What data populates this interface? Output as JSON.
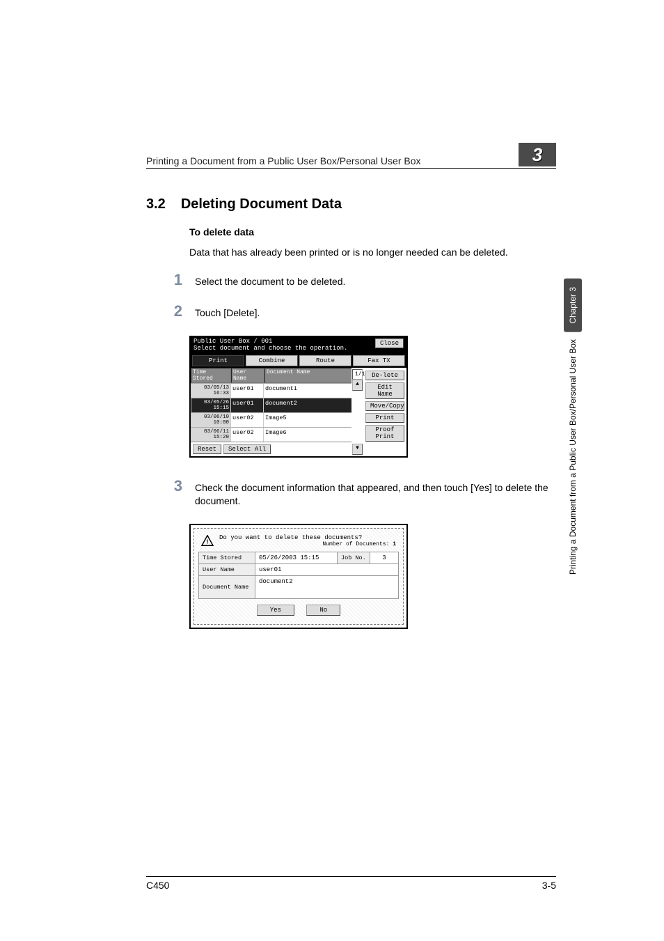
{
  "header": {
    "running_title": "Printing a Document from a Public User Box/Personal User Box",
    "chapter_number": "3"
  },
  "section": {
    "number": "3.2",
    "title": "Deleting Document Data",
    "subheading": "To delete data",
    "intro": "Data that has already been printed or is no longer needed can be deleted."
  },
  "steps": [
    {
      "n": "1",
      "text": "Select the document to be deleted."
    },
    {
      "n": "2",
      "text": "Touch [Delete]."
    },
    {
      "n": "3",
      "text": "Check the document information that appeared, and then touch [Yes] to delete the document."
    }
  ],
  "panel1": {
    "box_label": "Public User Box",
    "box_no": "/ 001",
    "instruction": "Select document and choose the operation.",
    "close": "Close",
    "tabs": [
      "Print",
      "Combine",
      "Route",
      "Fax TX"
    ],
    "col_time": "Time Stored",
    "col_user": "User Name",
    "col_doc": "Document Name",
    "page_indicator": "1/1",
    "rows": [
      {
        "time": "03/05/13 16:33",
        "user": "user01",
        "doc": "document1",
        "selected": false
      },
      {
        "time": "03/05/26 15:15",
        "user": "user01",
        "doc": "document2",
        "selected": true
      },
      {
        "time": "03/06/10 10:00",
        "user": "user02",
        "doc": "Image5",
        "selected": false
      },
      {
        "time": "03/06/11 15:20",
        "user": "user02",
        "doc": "Image6",
        "selected": false
      }
    ],
    "reset": "Reset",
    "select_all": "Select All",
    "side_buttons": [
      "De-lete",
      "Edit Name",
      "Move/Copy",
      "Print",
      "Proof Print"
    ]
  },
  "panel2": {
    "question": "Do you want to delete these documents?",
    "numdocs_label": "Number of Documents:",
    "numdocs_value": "1",
    "rows": {
      "time_label": "Time Stored",
      "time_value": "05/26/2003  15:15",
      "job_label": "Job No.",
      "job_value": "3",
      "user_label": "User Name",
      "user_value": "user01",
      "doc_label": "Document Name",
      "doc_value": "document2"
    },
    "yes": "Yes",
    "no": "No"
  },
  "side": {
    "chapter": "Chapter 3",
    "title": "Printing a Document from a Public User Box/Personal User Box"
  },
  "footer": {
    "model": "C450",
    "page": "3-5"
  }
}
